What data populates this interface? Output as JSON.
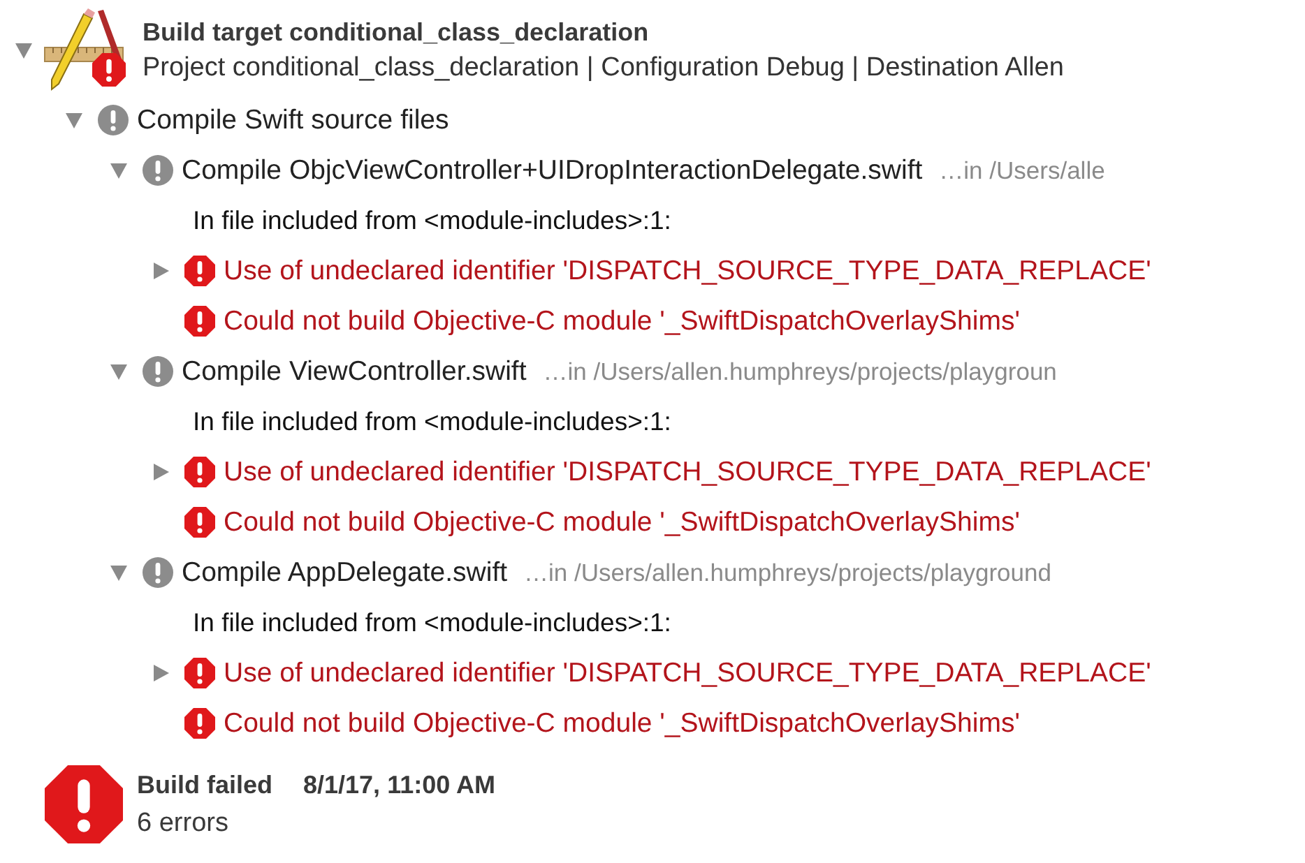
{
  "target": {
    "title": "Build target conditional_class_declaration",
    "subtitle": "Project conditional_class_declaration | Configuration Debug | Destination Allen",
    "expanded": true,
    "kind": "error",
    "steps": [
      {
        "title": "Compile Swift source files",
        "expanded": true,
        "kind": "warning",
        "children": [
          {
            "title": "Compile ObjcViewController+UIDropInteractionDelegate.swift",
            "path": "…in /Users/alle",
            "expanded": true,
            "kind": "warning",
            "messages": [
              {
                "kind": "note",
                "text": "In file included from <module-includes>:1:"
              },
              {
                "kind": "error",
                "text": "Use of undeclared identifier 'DISPATCH_SOURCE_TYPE_DATA_REPLACE'",
                "expanded": false
              },
              {
                "kind": "error",
                "text": "Could not build Objective-C module '_SwiftDispatchOverlayShims'"
              }
            ]
          },
          {
            "title": "Compile ViewController.swift",
            "path": "…in /Users/allen.humphreys/projects/playgroun",
            "expanded": true,
            "kind": "warning",
            "messages": [
              {
                "kind": "note",
                "text": "In file included from <module-includes>:1:"
              },
              {
                "kind": "error",
                "text": "Use of undeclared identifier 'DISPATCH_SOURCE_TYPE_DATA_REPLACE'",
                "expanded": false
              },
              {
                "kind": "error",
                "text": "Could not build Objective-C module '_SwiftDispatchOverlayShims'"
              }
            ]
          },
          {
            "title": "Compile AppDelegate.swift",
            "path": "…in /Users/allen.humphreys/projects/playground",
            "expanded": true,
            "kind": "warning",
            "messages": [
              {
                "kind": "note",
                "text": "In file included from <module-includes>:1:"
              },
              {
                "kind": "error",
                "text": "Use of undeclared identifier 'DISPATCH_SOURCE_TYPE_DATA_REPLACE'",
                "expanded": false
              },
              {
                "kind": "error",
                "text": "Could not build Objective-C module '_SwiftDispatchOverlayShims'"
              }
            ]
          }
        ]
      }
    ]
  },
  "summary": {
    "kind": "failed",
    "title": "Build failed",
    "time": "8/1/17, 11:00 AM",
    "detail": "6 errors"
  }
}
